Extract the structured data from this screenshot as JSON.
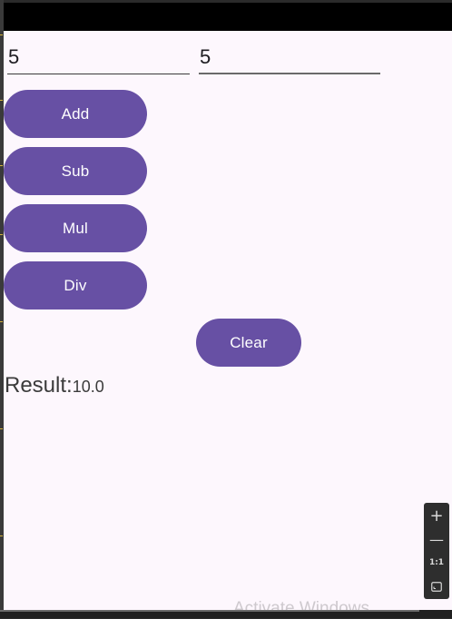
{
  "inputs": {
    "first_value": "5",
    "second_value": "5"
  },
  "buttons": {
    "add": "Add",
    "sub": "Sub",
    "mul": "Mul",
    "div": "Div",
    "clear": "Clear"
  },
  "result": {
    "label": "Result:",
    "value": "10.0"
  },
  "emulator_zoom": {
    "zoom_in": "+",
    "zoom_out": "—",
    "actual_size": "1:1",
    "fit_icon": "fit-screen-icon"
  },
  "watermark": "Activate Windows",
  "colors": {
    "button_fill": "#6750a4",
    "screen_background": "#fdf7fd",
    "status_bar": "#000000"
  }
}
